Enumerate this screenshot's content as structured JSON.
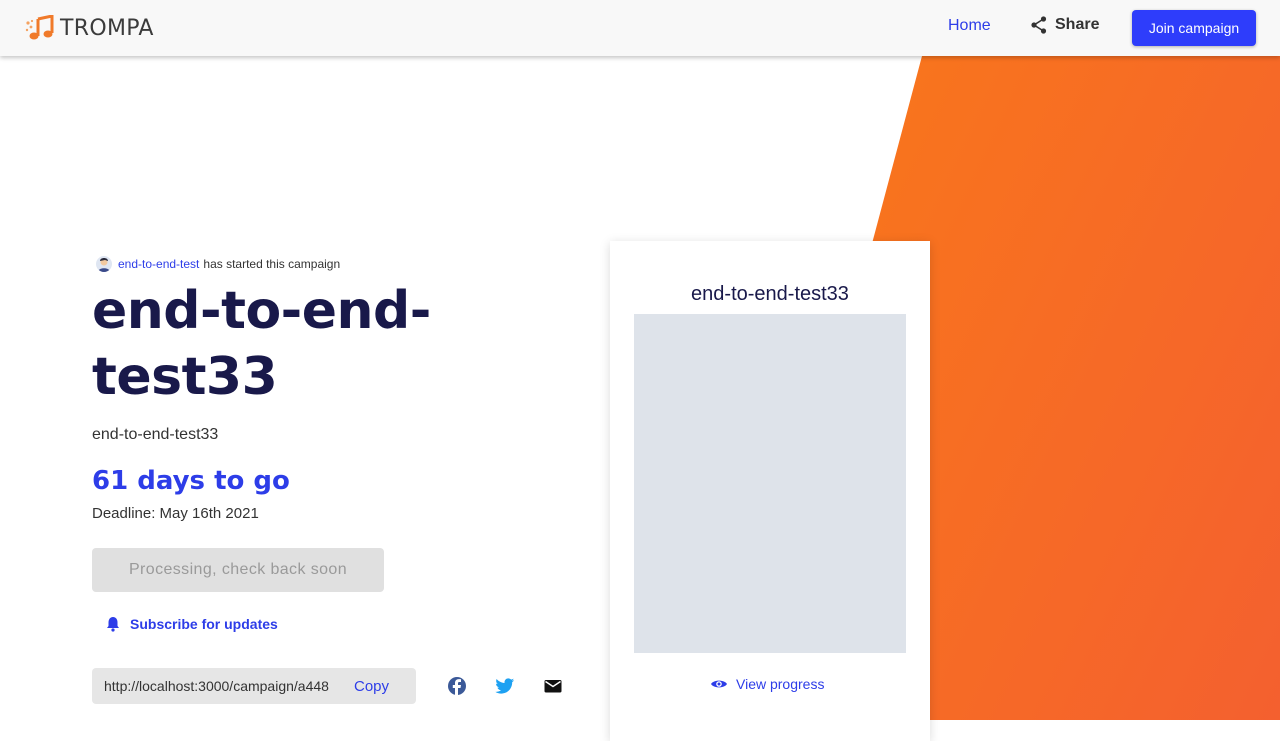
{
  "header": {
    "brand": "TROMPA",
    "nav_home": "Home",
    "share_label": "Share",
    "join_label": "Join campaign"
  },
  "campaign": {
    "starter_name": "end-to-end-test",
    "starter_text": "has started this campaign",
    "title": "end-to-end-test33",
    "subtitle": "end-to-end-test33",
    "days_to_go": "61 days to go",
    "deadline": "Deadline: May 16th 2021",
    "processing_label": "Processing, check back soon",
    "subscribe_label": "Subscribe for updates",
    "share_url": "http://localhost:3000/campaign/a448",
    "copy_label": "Copy"
  },
  "card": {
    "title": "end-to-end-test33",
    "view_progress_label": "View progress"
  },
  "icons": {
    "logo": "trompa-music-note-logo",
    "share": "share-icon",
    "bell": "bell-icon",
    "facebook": "facebook-icon",
    "twitter": "twitter-icon",
    "email": "email-icon",
    "eye": "eye-icon"
  },
  "colors": {
    "accent": "#2d3de8",
    "button_primary": "#2e3dfb",
    "title": "#19194a",
    "hero_gradient_start": "#ff8f00",
    "hero_gradient_end": "#f4602f",
    "facebook": "#3b5998",
    "twitter": "#1da1f2"
  }
}
